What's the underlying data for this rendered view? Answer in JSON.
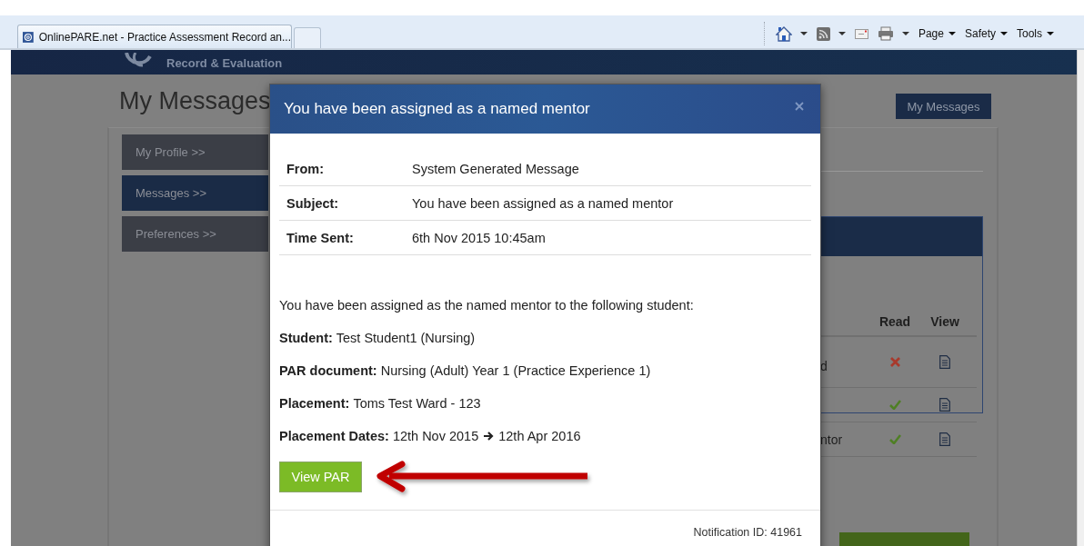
{
  "browser": {
    "tab": {
      "title": "OnlinePARE.net - Practice Assessment Record an..."
    },
    "command_bar": [
      {
        "kind": "home",
        "dropdown": true
      },
      {
        "kind": "feeds",
        "dropdown": true
      },
      {
        "kind": "mail",
        "dropdown": false
      },
      {
        "kind": "print",
        "dropdown": true
      },
      {
        "kind": "menu",
        "label": "Page",
        "dropdown": true
      },
      {
        "kind": "menu",
        "label": "Safety",
        "dropdown": true
      },
      {
        "kind": "menu",
        "label": "Tools",
        "dropdown": true
      }
    ]
  },
  "site": {
    "brand": "Record & Evaluation"
  },
  "page": {
    "title": "My Messages",
    "top_button": "My Messages",
    "sidebar": [
      {
        "label": "My Profile >>",
        "selected": false
      },
      {
        "label": "Messages >>",
        "selected": true
      },
      {
        "label": "Preferences >>",
        "selected": false
      }
    ],
    "messages_table": {
      "columns": [
        "Read",
        "View"
      ],
      "rows": [
        {
          "subject": "d",
          "read": false
        },
        {
          "read": true
        },
        {
          "subject": "ntor",
          "read": true
        }
      ]
    }
  },
  "modal": {
    "title": "You have been assigned as a named mentor",
    "meta": [
      {
        "label": "From:",
        "value": "System Generated Message"
      },
      {
        "label": "Subject:",
        "value": "You have been assigned as a named mentor"
      },
      {
        "label": "Time Sent:",
        "value": "6th Nov 2015 10:45am"
      }
    ],
    "intro": "You have been assigned as the named mentor to the following student:",
    "details": [
      {
        "kind": "text",
        "label": "Student:",
        "value": "Test Student1 (Nursing)"
      },
      {
        "kind": "text",
        "label": "PAR document:",
        "value": "Nursing (Adult) Year 1 (Practice Experience 1)"
      },
      {
        "kind": "text",
        "label": "Placement:",
        "value": "Toms Test Ward - 123"
      },
      {
        "kind": "date_range",
        "label": "Placement Dates:",
        "start": "12th Nov 2015",
        "end": "12th Apr 2016"
      }
    ],
    "button": "View PAR",
    "notification": "Notification ID: 41961"
  }
}
